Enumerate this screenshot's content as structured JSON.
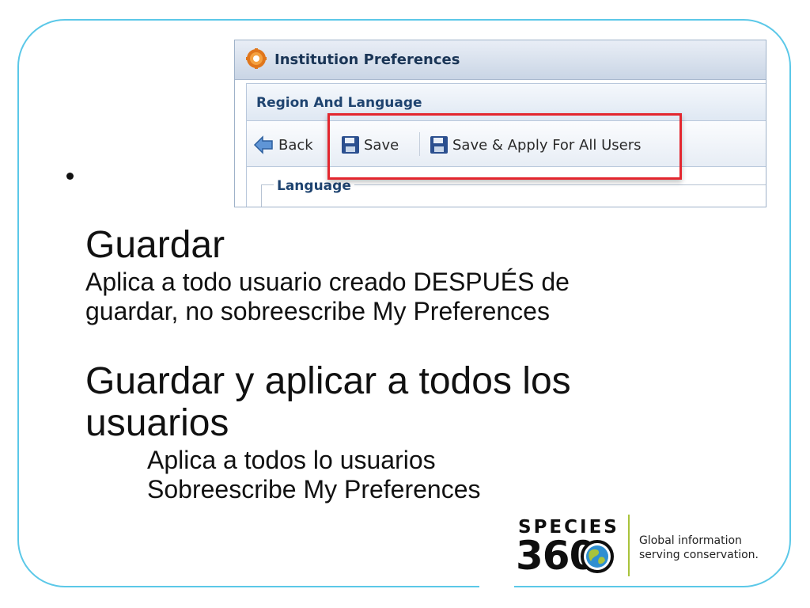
{
  "window": {
    "title": "Institution Preferences",
    "section": "Region And Language",
    "fieldset_legend": "Language"
  },
  "toolbar": {
    "back_label": "Back",
    "save_label": "Save",
    "save_apply_label": "Save & Apply For All Users"
  },
  "slide": {
    "heading1": "Guardar",
    "desc1_line1": "Aplica a todo usuario creado DESPUÉS de",
    "desc1_line2": "guardar, no sobreescribe My Preferences",
    "heading2_line1": "Guardar y aplicar a todos los",
    "heading2_line2": "usuarios",
    "desc2_line1": "Aplica a todos lo usuarios",
    "desc2_line2": "Sobreescribe My Preferences"
  },
  "logo": {
    "word1": "SPECIES",
    "word2": "360",
    "tagline_line1": "Global information",
    "tagline_line2": "serving conservation."
  },
  "colors": {
    "frame": "#5bc8e8",
    "highlight": "#e3262e",
    "logo_accent": "#a9c33b"
  }
}
